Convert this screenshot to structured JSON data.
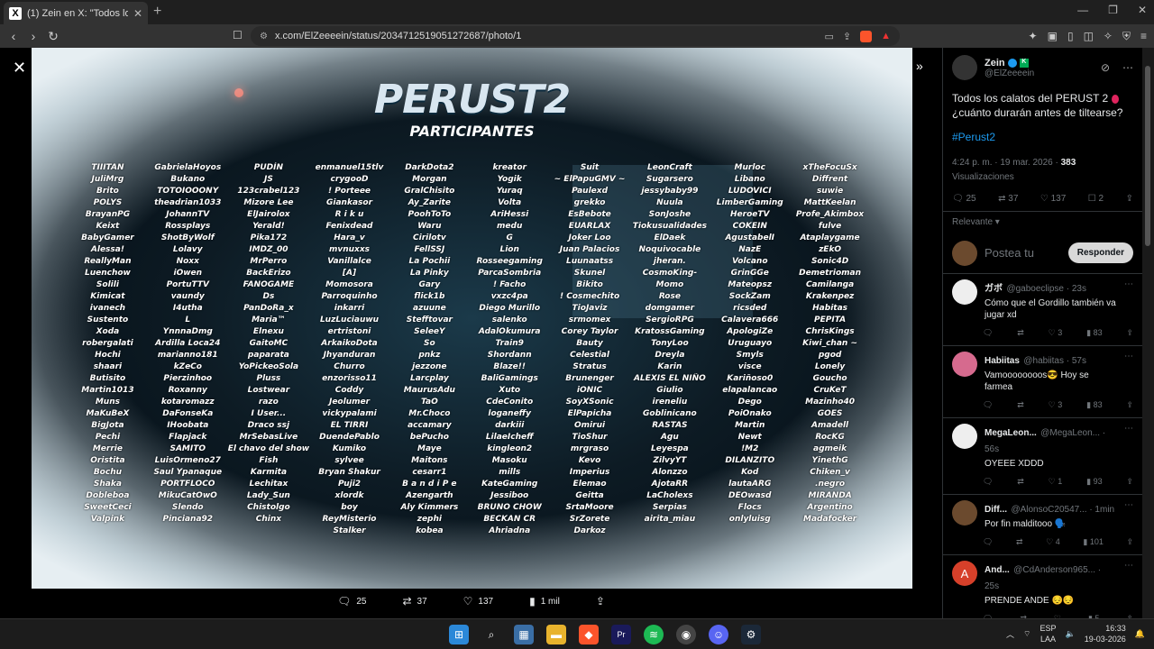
{
  "browser": {
    "tab_title": "(1) Zein en X: \"Todos los calatos",
    "url": "x.com/ElZeeeein/status/2034712519051272687/photo/1"
  },
  "poster": {
    "title": "PERUST2",
    "subtitle": "PARTICIPANTES",
    "columns": [
      [
        "TIIITAN",
        "JuliMrg",
        "Brito",
        "POLYS",
        "BrayanPG",
        "Keixt",
        "BabyGamer",
        "Alessa!",
        "ReallyMan",
        "Luenchow",
        "Solili",
        "Kimicat",
        "ivanech",
        "Sustento",
        "Xoda",
        "robergalati",
        "Hochi",
        "shaari",
        "Butisito",
        "Martin1013",
        "Muns",
        "MaKuBeX",
        "BigJota",
        "Pechi",
        "Merrie",
        "Oristita",
        "Bochu",
        "Shaka",
        "Dobleboa",
        "SweetCeci",
        "Valpink"
      ],
      [
        "GabrielaHoyos",
        "Bukano",
        "TOTOIOOONY",
        "theadrian1033",
        "JohannTV",
        "Rossplays",
        "ShotByWolf",
        "Lolavy",
        "Noxx",
        "iOwen",
        "PortuTTV",
        "vaundy",
        "I4utha",
        "L",
        "YnnnaDmg",
        "Ardilla Loca24",
        "marianno181",
        "kZeCo",
        "Pierzinhoo",
        "Roxanny",
        "kotaromazz",
        "DaFonseKa",
        "IHoobata",
        "Flapjack",
        "SAMITO",
        "LuisOrmeno27",
        "Saul Ypanaque",
        "PORTFLOCO",
        "MikuCatOwO",
        "Slendo",
        "Pinciana92"
      ],
      [
        "PUDÍN",
        "JS",
        "123crabel123",
        "Mizore Lee",
        "ElJairolox",
        "Yerald!",
        "Pika172",
        "IMDZ_00",
        "MrPerro",
        "BackErizo",
        "FANOGAME",
        "Ds",
        "PanDoRa_x",
        "Maria™",
        "Elnexu",
        "GaitoMC",
        "paparata",
        "YoPickeoSola",
        "Pluss",
        "Lostwear",
        "razo",
        "I User...",
        "Draco ssj",
        "MrSebasLive",
        "El chavo del show",
        "Fish",
        "Karmita",
        "Lechitax",
        "Lady_Sun",
        "Chistolgo",
        "Chinx"
      ],
      [
        "enmanuel15tlv",
        "crygooD",
        "! Porteee",
        "Giankasor",
        "R i k u",
        "Fenixdead",
        "Hara_v",
        "mvnuxxs",
        "Vanillalce",
        "[A]",
        "Momosora",
        "Parroquinho",
        "inkarri",
        "LuzLuciauwu",
        "ertristoni",
        "ArkaikoDota",
        "Jhyanduran",
        "Churro",
        "enzorisso11",
        "Coddy",
        "Jeolumer",
        "vickypalami",
        "EL TIRRI",
        "DuendePablo",
        "Kumiko",
        "sylvee",
        "Bryan Shakur",
        "Puji2",
        "xlordk",
        "boy",
        "ReyMisterio",
        "Stalker"
      ],
      [
        "DarkDota2",
        "Morgan",
        "GralChisito",
        "Ay_Zarite",
        "PoohToTo",
        "Waru",
        "Cirilotv",
        "FellSSJ",
        "La Pochii",
        "La Pinky",
        "Gary",
        "flick1b",
        "azuune",
        "Stefftovar",
        "SeleeY",
        "So",
        "pnkz",
        "jezzone",
        "Larcplay",
        "MaurusAdu",
        "TaO",
        "Mr.Choco",
        "accamary",
        "bePucho",
        "Maye",
        "Maitons",
        "cesarr1",
        "B a n d i P e",
        "Azengarth",
        "Aly Kimmers",
        "zephi",
        "kobea"
      ],
      [
        "kreator",
        "Yogik",
        "Yuraq",
        "Volta",
        "AriHessi",
        "medu",
        "G",
        "Lion",
        "Rosseegaming",
        "ParcaSombria",
        "! Facho",
        "vxzc4pa",
        "Diego Murillo",
        "salenko",
        "AdalOkumura",
        "Train9",
        "Shordann",
        "Blaze!!",
        "BaliGamings",
        "Xuto",
        "CdeConito",
        "loganeffy",
        "darkiii",
        "LilaeIcheff",
        "kingleon2",
        "Masoku",
        "mills",
        "KateGaming",
        "Jessiboo",
        "BRUNO CHOW",
        "BECKAN CR",
        "Ahriadna"
      ],
      [
        "Suit",
        "~ ElPapuGMV ~",
        "Paulexd",
        "grekko",
        "EsBebote",
        "EUARLAX",
        "Joker Loo",
        "Juan Palacios",
        "Luunaatss",
        "Skunel",
        "Bikito",
        "! Cosmechito",
        "TioJaviz",
        "srmomex",
        "Corey Taylor",
        "Bauty",
        "Celestial",
        "Stratus",
        "Brunenger",
        "iONIC",
        "SoyXSonic",
        "ElPapicha",
        "Omirui",
        "TioShur",
        "mrgraso",
        "Kevo",
        "Imperius",
        "Elemao",
        "Geitta",
        "SrtaMoore",
        "SrZorete",
        "Darkoz"
      ],
      [
        "LeonCraft",
        "Sugarsero",
        "jessybaby99",
        "Nuula",
        "SonJoshe",
        "Tiokusualidades",
        "ElDaek",
        "Noquivocable",
        "jheran.",
        "CosmoKing-",
        "Momo",
        "Rose",
        "domgamer",
        "SergioRPG",
        "KratossGaming",
        "TonyLoo",
        "Dreyla",
        "Karin",
        "ALEXIS EL NIÑO",
        "Giulio",
        "ireneliu",
        "Goblinicano",
        "RASTAS",
        "Agu",
        "Leyespa",
        "ZilvyYT",
        "Alonzzo",
        "AjotaRR",
        "LaCholexs",
        "Serpias",
        "airita_miau"
      ],
      [
        "Murloc",
        "Libano",
        "LUDOVICI",
        "LimberGaming",
        "HeroeTV",
        "COKEIN",
        "AgustabelI",
        "NazE",
        "Volcano",
        "GrinGGe",
        "Mateopsz",
        "SockZam",
        "ricsded",
        "Calavera666",
        "ApologiZe",
        "Uruguayo",
        "Smyls",
        "visce",
        "Kariñoso0",
        "elapalancao",
        "Dego",
        "PoiOnako",
        "Martin",
        "Newt",
        "!M2",
        "DILANZITO",
        "Kod",
        "lautaARG",
        "DEOwasd",
        "Flocs",
        "onlyluisg"
      ],
      [
        "xTheFocuSx",
        "Diffrent",
        "suwie",
        "MattKeelan",
        "Profe_Akimbox",
        "fulve",
        "Ataplaygame",
        "zEkO",
        "Sonic4D",
        "Demetrioman",
        "Camilanga",
        "Krakenpez",
        "Habitas",
        "PEPITA",
        "ChrisKings",
        "Kiwi_chan ~",
        "pgod",
        "Lonely",
        "Goucho",
        "CruKeT",
        "Mazinho40",
        "GOES",
        "Amadell",
        "RocKG",
        "agmeik",
        "YinethG",
        "Chiken_v",
        ".negro",
        "MIRANDA",
        "Argentino",
        "Madafocker"
      ]
    ]
  },
  "photo_metrics": {
    "replies": "25",
    "reposts": "37",
    "likes": "137",
    "views": "1 mil"
  },
  "post": {
    "author_name": "Zein",
    "author_handle": "@ElZeeeein",
    "text_line1": "Todos los calatos del PERUST 2",
    "text_line2": "¿cuánto durarán antes de tiltearse?",
    "hashtag": "#Perust2",
    "time": "4:24 p. m. · 19 mar. 2026 ·",
    "views_count": "383",
    "views_label": "Visualizaciones",
    "replies": "25",
    "reposts": "37",
    "likes": "137",
    "bookmarks": "2",
    "sort_label": "Relevante",
    "reply_placeholder": "Postea tu",
    "reply_button": "Responder"
  },
  "replies": [
    {
      "name": "ガボ",
      "handle": "@gaboeclipse · 23s",
      "text": "Cómo que el Gordillo también va jugar xd",
      "reposts": "",
      "likes": "3",
      "views": "83",
      "avatar": "white"
    },
    {
      "name": "Habiitas",
      "handle": "@habiitas · 57s",
      "text": "Vamoooooooos😎 Hoy se farmea",
      "reposts": "",
      "likes": "3",
      "views": "83",
      "avatar": "pink"
    },
    {
      "name": "MegaLeon...",
      "handle": "@MegaLeon... · 56s",
      "text": "OYEEE XDDD",
      "reposts": "",
      "likes": "1",
      "views": "93",
      "avatar": "white"
    },
    {
      "name": "Diff...",
      "handle": "@AlonsoC20547... · 1min",
      "text": "Por fin malditooo 🗣️",
      "reposts": "",
      "likes": "4",
      "views": "101",
      "avatar": "brown"
    },
    {
      "name": "And...",
      "handle": "@CdAnderson965... · 25s",
      "text": "PRENDE ANDE 😔😔",
      "reposts": "",
      "likes": "",
      "views": "5",
      "avatar": "red",
      "initial": "A"
    },
    {
      "name": "good 001",
      "handle": "@aelouabcdefj · 3min",
      "text": "",
      "reposts": "",
      "likes": "",
      "views": "",
      "avatar": "gray"
    }
  ],
  "taskbar": {
    "lang_top": "ESP",
    "lang_bottom": "LAA",
    "time": "16:33",
    "date": "19-03-2026"
  }
}
